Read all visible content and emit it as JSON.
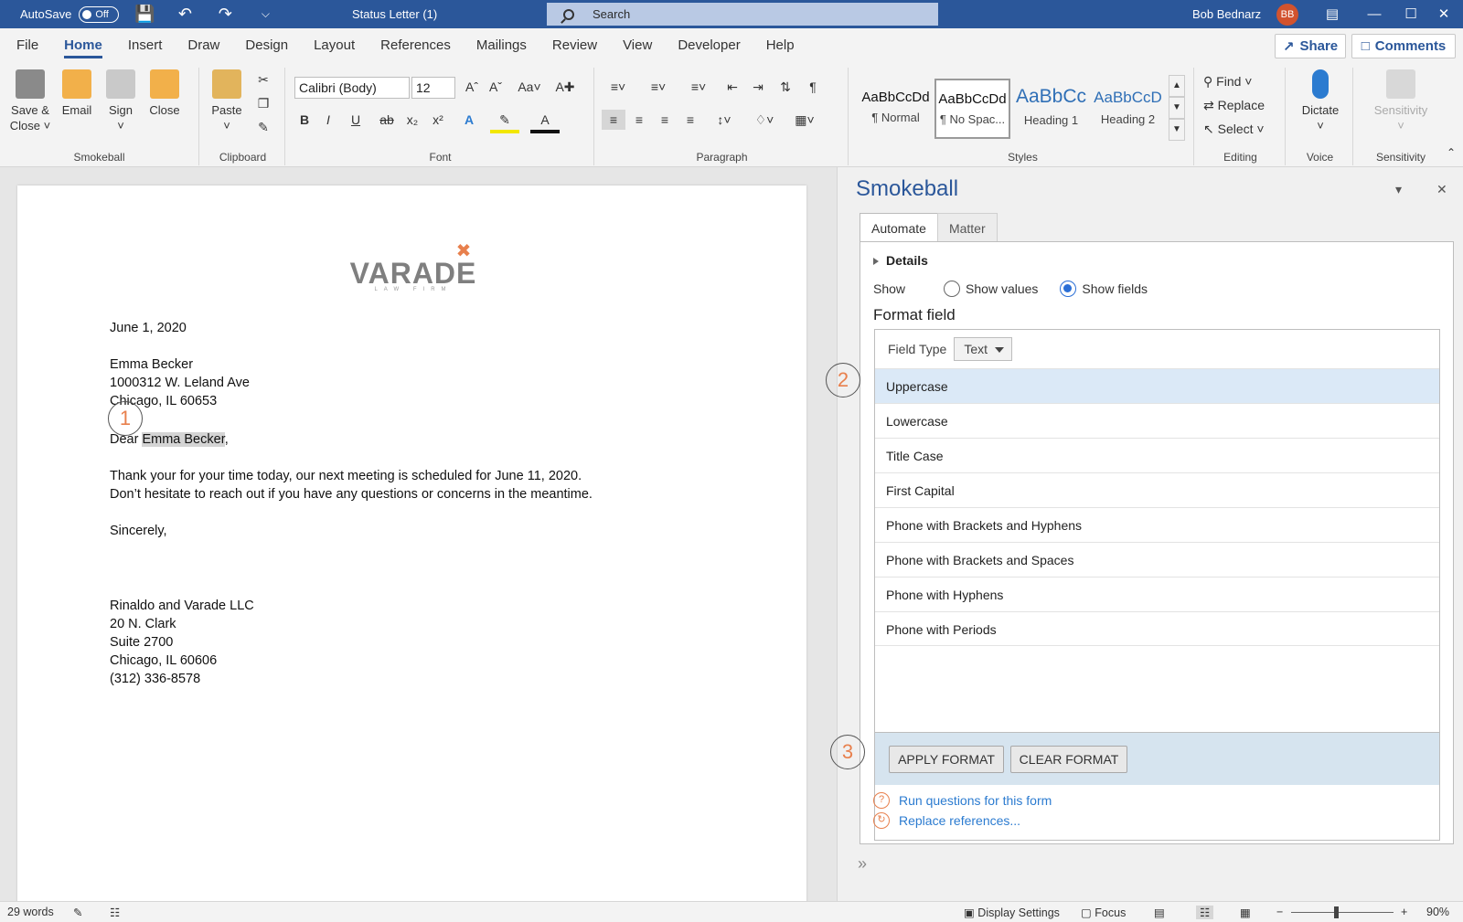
{
  "titlebar": {
    "autosave_label": "AutoSave",
    "autosave_state": "Off",
    "doc_title": "Status Letter (1)",
    "search_placeholder": "Search",
    "user_name": "Bob Bednarz",
    "user_initials": "BB"
  },
  "menu": {
    "tabs": [
      "File",
      "Home",
      "Insert",
      "Draw",
      "Design",
      "Layout",
      "References",
      "Mailings",
      "Review",
      "View",
      "Developer",
      "Help"
    ],
    "share_label": "Share",
    "comments_label": "Comments"
  },
  "ribbon": {
    "smokeball": {
      "label": "Smokeball",
      "save_close": "Save &",
      "save_close2": "Close",
      "email": "Email",
      "sign": "Sign",
      "close": "Close"
    },
    "clipboard": {
      "label": "Clipboard",
      "paste": "Paste"
    },
    "font": {
      "label": "Font",
      "font_name": "Calibri (Body)",
      "font_size": "12"
    },
    "paragraph": {
      "label": "Paragraph"
    },
    "styles": {
      "label": "Styles",
      "items": [
        {
          "preview": "AaBbCcDd",
          "name": "¶ Normal"
        },
        {
          "preview": "AaBbCcDd",
          "name": "¶ No Spac..."
        },
        {
          "preview": "AaBbCc",
          "name": "Heading 1"
        },
        {
          "preview": "AaBbCcD",
          "name": "Heading 2"
        }
      ]
    },
    "editing": {
      "label": "Editing",
      "find": "Find",
      "replace": "Replace",
      "select": "Select"
    },
    "voice": {
      "label": "Voice",
      "dictate": "Dictate"
    },
    "sensitivity": {
      "label": "Sensitivity",
      "btn": "Sensitivity"
    }
  },
  "document": {
    "logo_word": "VARADE",
    "logo_sub": "LAW FIRM",
    "date": "June 1, 2020",
    "recipient_name": "Emma Becker",
    "address1": "1000312 W. Leland Ave",
    "address2": "Chicago, IL 60653",
    "greeting_prefix": "Dear ",
    "greeting_name": "Emma Becker",
    "greeting_suffix": ",",
    "body1": "Thank your for your time today, our next meeting is scheduled for June 11, 2020.",
    "body2": "Don’t hesitate to reach out if you have any questions or concerns in the meantime.",
    "closing": "Sincerely,",
    "firm": "Rinaldo and Varade LLC",
    "firm_addr1": "20 N. Clark",
    "firm_addr2": "Suite 2700",
    "firm_addr3": "Chicago, IL 60606",
    "firm_phone": "(312) 336-8578",
    "callout1": "1"
  },
  "pane": {
    "title": "Smokeball",
    "tabs": [
      "Automate",
      "Matter"
    ],
    "details_label": "Details",
    "show_label": "Show",
    "show_values": "Show values",
    "show_fields": "Show fields",
    "format_field_title": "Format field",
    "field_type_label": "Field Type",
    "field_type_value": "Text",
    "options": [
      "Uppercase",
      "Lowercase",
      "Title Case",
      "First Capital",
      "Phone with Brackets and Hyphens",
      "Phone with Brackets and Spaces",
      "Phone with Hyphens",
      "Phone with Periods"
    ],
    "apply_format": "APPLY FORMAT",
    "clear_format": "CLEAR FORMAT",
    "run_questions": "Run questions for this form",
    "replace_refs": "Replace references...",
    "callout2": "2",
    "callout3": "3"
  },
  "status": {
    "words": "29 words",
    "display_settings": "Display Settings",
    "focus": "Focus",
    "zoom": "90%"
  },
  "colors": {
    "brand": "#2b579a",
    "accent": "#e8804d",
    "link": "#2b7bd0"
  }
}
